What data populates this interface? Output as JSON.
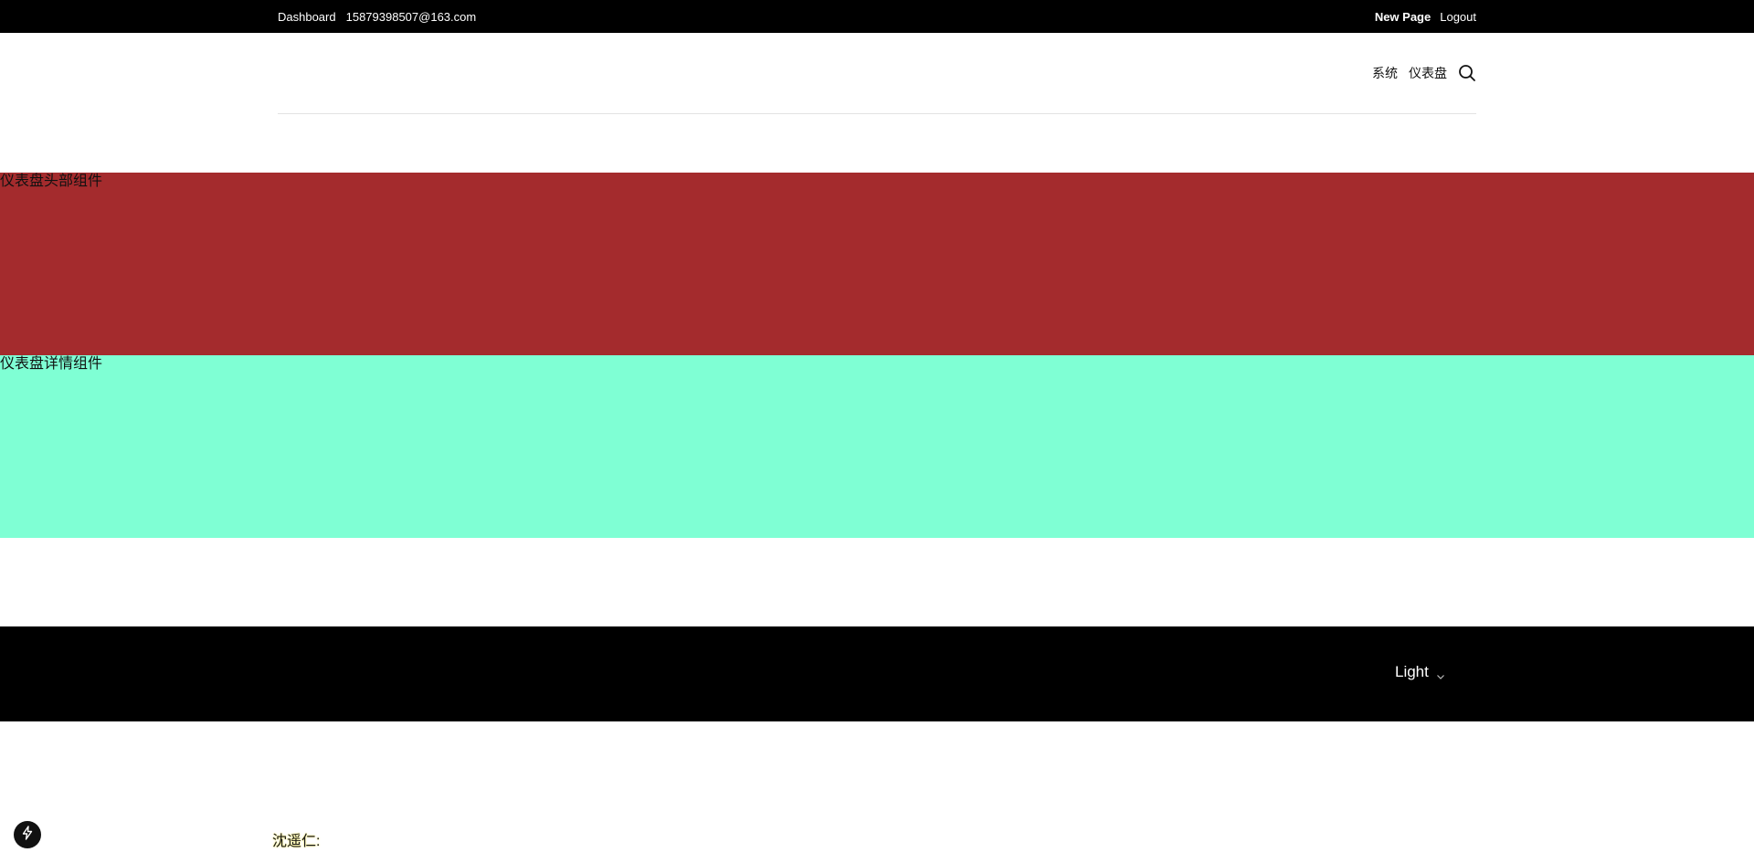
{
  "topbar": {
    "left_links": [
      "Dashboard",
      "15879398507@163.com"
    ],
    "new_page_label": "New Page",
    "logout_label": "Logout"
  },
  "nav": {
    "items": [
      "系统",
      "仪表盘"
    ],
    "search_icon": "search-icon"
  },
  "panels": {
    "header_label": "仪表盘头部组件",
    "header_color": "#a42b2d",
    "detail_label": "仪表盘详情组件",
    "detail_color": "#7fffd4"
  },
  "footer": {
    "theme_value": "Light",
    "theme_icon": "chevron-down-icon"
  },
  "fab": {
    "icon": "lightning-icon"
  },
  "bottom": {
    "text": "沈遥仁:"
  }
}
